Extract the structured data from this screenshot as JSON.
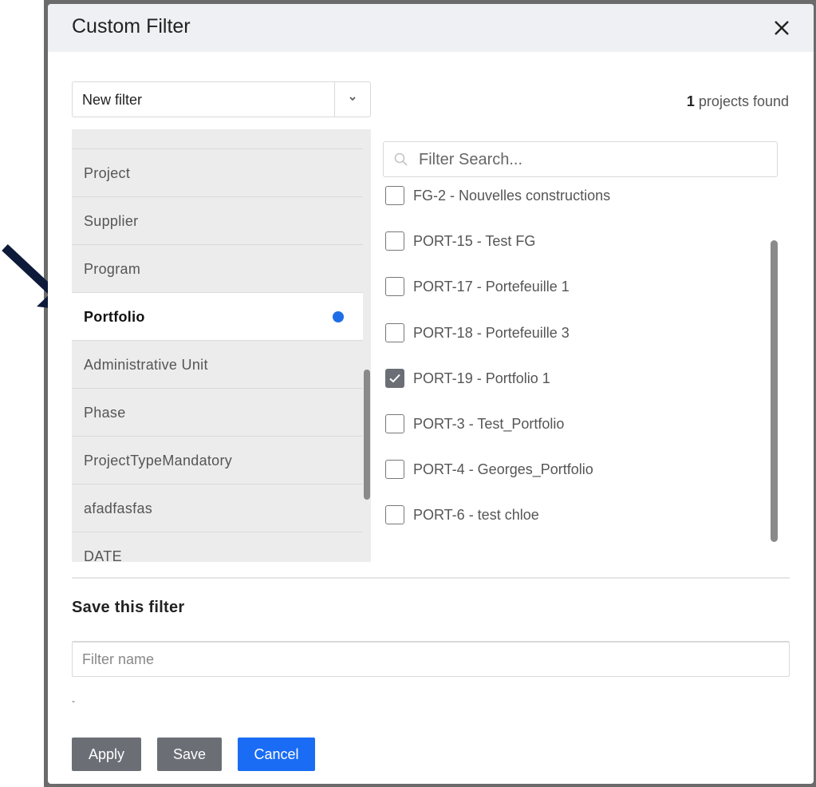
{
  "dialog": {
    "title": "Custom Filter",
    "close_icon": "close-icon"
  },
  "filter_select": {
    "value": "New filter",
    "chevron_icon": "chevron-down-icon"
  },
  "results": {
    "count": "1",
    "suffix": " projects found"
  },
  "categories": [
    {
      "label": "Project",
      "active": false
    },
    {
      "label": "Supplier",
      "active": false
    },
    {
      "label": "Program",
      "active": false
    },
    {
      "label": "Portfolio",
      "active": true
    },
    {
      "label": "Administrative Unit",
      "active": false
    },
    {
      "label": "Phase",
      "active": false
    },
    {
      "label": "ProjectTypeMandatory",
      "active": false
    },
    {
      "label": "afadfasfas",
      "active": false
    },
    {
      "label": "DATE",
      "active": false
    }
  ],
  "search": {
    "placeholder": "Filter Search...",
    "icon": "search-icon"
  },
  "options": [
    {
      "label": "FG-2 - Nouvelles constructions",
      "checked": false
    },
    {
      "label": "PORT-15 - Test FG",
      "checked": false
    },
    {
      "label": "PORT-17 - Portefeuille 1",
      "checked": false
    },
    {
      "label": "PORT-18 - Portefeuille 3",
      "checked": false
    },
    {
      "label": "PORT-19 - Portfolio 1",
      "checked": true
    },
    {
      "label": "PORT-3 - Test_Portfolio",
      "checked": false
    },
    {
      "label": "PORT-4 - Georges_Portfolio",
      "checked": false
    },
    {
      "label": "PORT-6 - test chloe",
      "checked": false
    }
  ],
  "save_section": {
    "title": "Save this filter",
    "name_placeholder": "Filter name",
    "name_value": "",
    "note": "-"
  },
  "buttons": {
    "apply": "Apply",
    "save": "Save",
    "cancel": "Cancel"
  },
  "colors": {
    "accent": "#1a6cf5",
    "active_dot": "#1e6fe6",
    "button_gray": "#6b6f75",
    "arrow": "#0d1a3a"
  }
}
